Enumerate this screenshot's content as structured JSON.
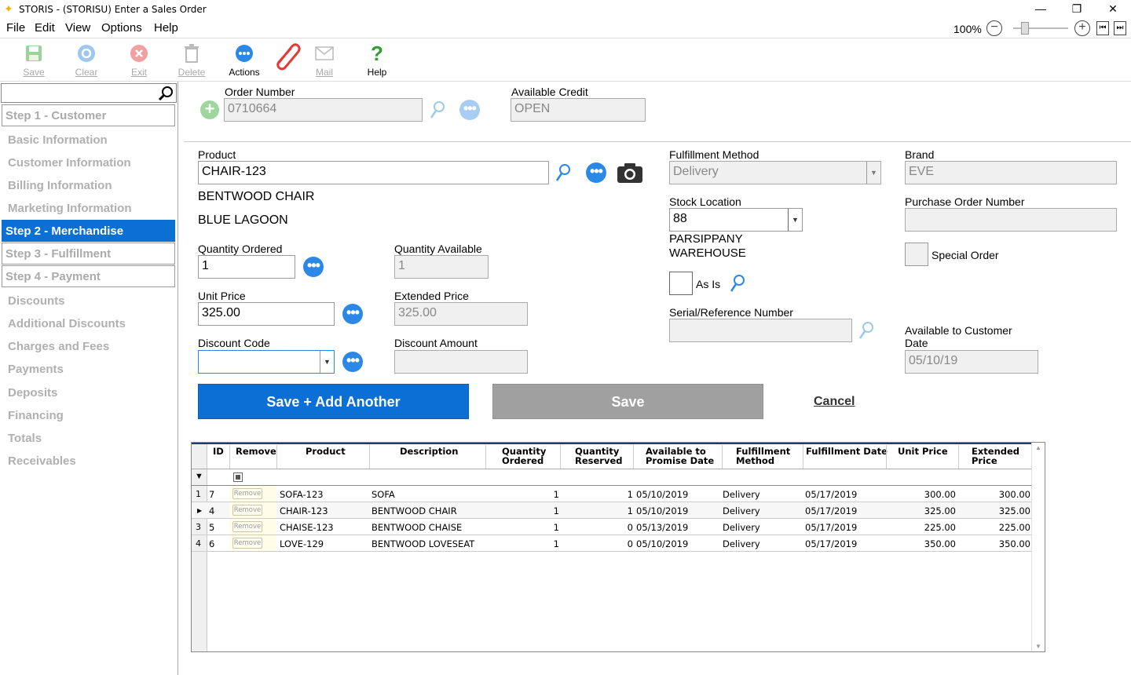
{
  "window": {
    "title": "STORIS - (STORISU) Enter a Sales Order",
    "minimize": "—",
    "restore": "❐",
    "close": "✕"
  },
  "menu": [
    "File",
    "Edit",
    "View",
    "Options",
    "Help"
  ],
  "zoom": {
    "level": "100%"
  },
  "toolbar": {
    "save": "Save",
    "clear": "Clear",
    "exit": "Exit",
    "delete": "Delete",
    "actions": "Actions",
    "mail": "Mail",
    "help": "Help"
  },
  "sidebar": {
    "step1": "Step 1 - Customer",
    "basic": "Basic Information",
    "customer": "Customer Information",
    "billing": "Billing Information",
    "marketing": "Marketing Information",
    "step2": "Step 2 - Merchandise",
    "step3": "Step 3 - Fulfillment",
    "step4": "Step 4 - Payment",
    "discounts": "Discounts",
    "additional": "Additional Discounts",
    "charges": "Charges and Fees",
    "payments": "Payments",
    "deposits": "Deposits",
    "financing": "Financing",
    "totals": "Totals",
    "receivables": "Receivables"
  },
  "order": {
    "number_label": "Order Number",
    "number": "0710664",
    "credit_label": "Available Credit",
    "credit": "OPEN"
  },
  "form": {
    "product_label": "Product",
    "product": "CHAIR-123",
    "desc1": "BENTWOOD CHAIR",
    "desc2": "BLUE LAGOON",
    "qty_ordered_label": "Quantity Ordered",
    "qty_ordered": "1",
    "qty_avail_label": "Quantity Available",
    "qty_avail": "1",
    "unit_price_label": "Unit Price",
    "unit_price": "325.00",
    "ext_price_label": "Extended Price",
    "ext_price": "325.00",
    "disc_code_label": "Discount Code",
    "disc_code": "",
    "disc_amount_label": "Discount Amount",
    "disc_amount": "",
    "fulfill_label": "Fulfillment Method",
    "fulfill": "Delivery",
    "stock_label": "Stock Location",
    "stock": "88",
    "stock_name1": "PARSIPPANY",
    "stock_name2": "WAREHOUSE",
    "asis_label": "As Is",
    "serial_label": "Serial/Reference Number",
    "serial": "",
    "brand_label": "Brand",
    "brand": "EVE",
    "po_label": "Purchase Order Number",
    "po": "",
    "special_label": "Special Order",
    "avail_date_label1": "Available to Customer",
    "avail_date_label2": "Date",
    "avail_date": "05/10/19"
  },
  "buttons": {
    "save_add": "Save + Add Another",
    "save": "Save",
    "cancel": "Cancel"
  },
  "grid": {
    "headers": {
      "id": "ID",
      "remove": "Remove",
      "product": "Product",
      "description": "Description",
      "qty_ordered1": "Quantity",
      "qty_ordered2": "Ordered",
      "qty_reserved1": "Quantity",
      "qty_reserved2": "Reserved",
      "atp1": "Available to",
      "atp2": "Promise Date",
      "fm1": "Fulfillment",
      "fm2": "Method",
      "fdate": "Fulfillment Date",
      "unit": "Unit Price",
      "ext1": "Extended",
      "ext2": "Price"
    },
    "remove_label": "Remove",
    "rows": [
      {
        "n": "1",
        "id": "7",
        "product": "SOFA-123",
        "desc": "SOFA",
        "qo": "1",
        "qr": "1",
        "atp": "05/10/2019",
        "fm": "Delivery",
        "fd": "05/17/2019",
        "unit": "300.00",
        "ext": "300.00"
      },
      {
        "n": "",
        "id": "4",
        "product": "CHAIR-123",
        "desc": "BENTWOOD CHAIR",
        "qo": "1",
        "qr": "1",
        "atp": "05/10/2019",
        "fm": "Delivery",
        "fd": "05/17/2019",
        "unit": "325.00",
        "ext": "325.00"
      },
      {
        "n": "3",
        "id": "5",
        "product": "CHAISE-123",
        "desc": "BENTWOOD CHAISE",
        "qo": "1",
        "qr": "0",
        "atp": "05/13/2019",
        "fm": "Delivery",
        "fd": "05/17/2019",
        "unit": "225.00",
        "ext": "225.00"
      },
      {
        "n": "4",
        "id": "6",
        "product": "LOVE-129",
        "desc": "BENTWOOD LOVESEAT",
        "qo": "1",
        "qr": "0",
        "atp": "05/10/2019",
        "fm": "Delivery",
        "fd": "05/17/2019",
        "unit": "350.00",
        "ext": "350.00"
      }
    ]
  },
  "colors": {
    "accent": "#0b6fd3",
    "disabled": "#a0a0a0"
  }
}
